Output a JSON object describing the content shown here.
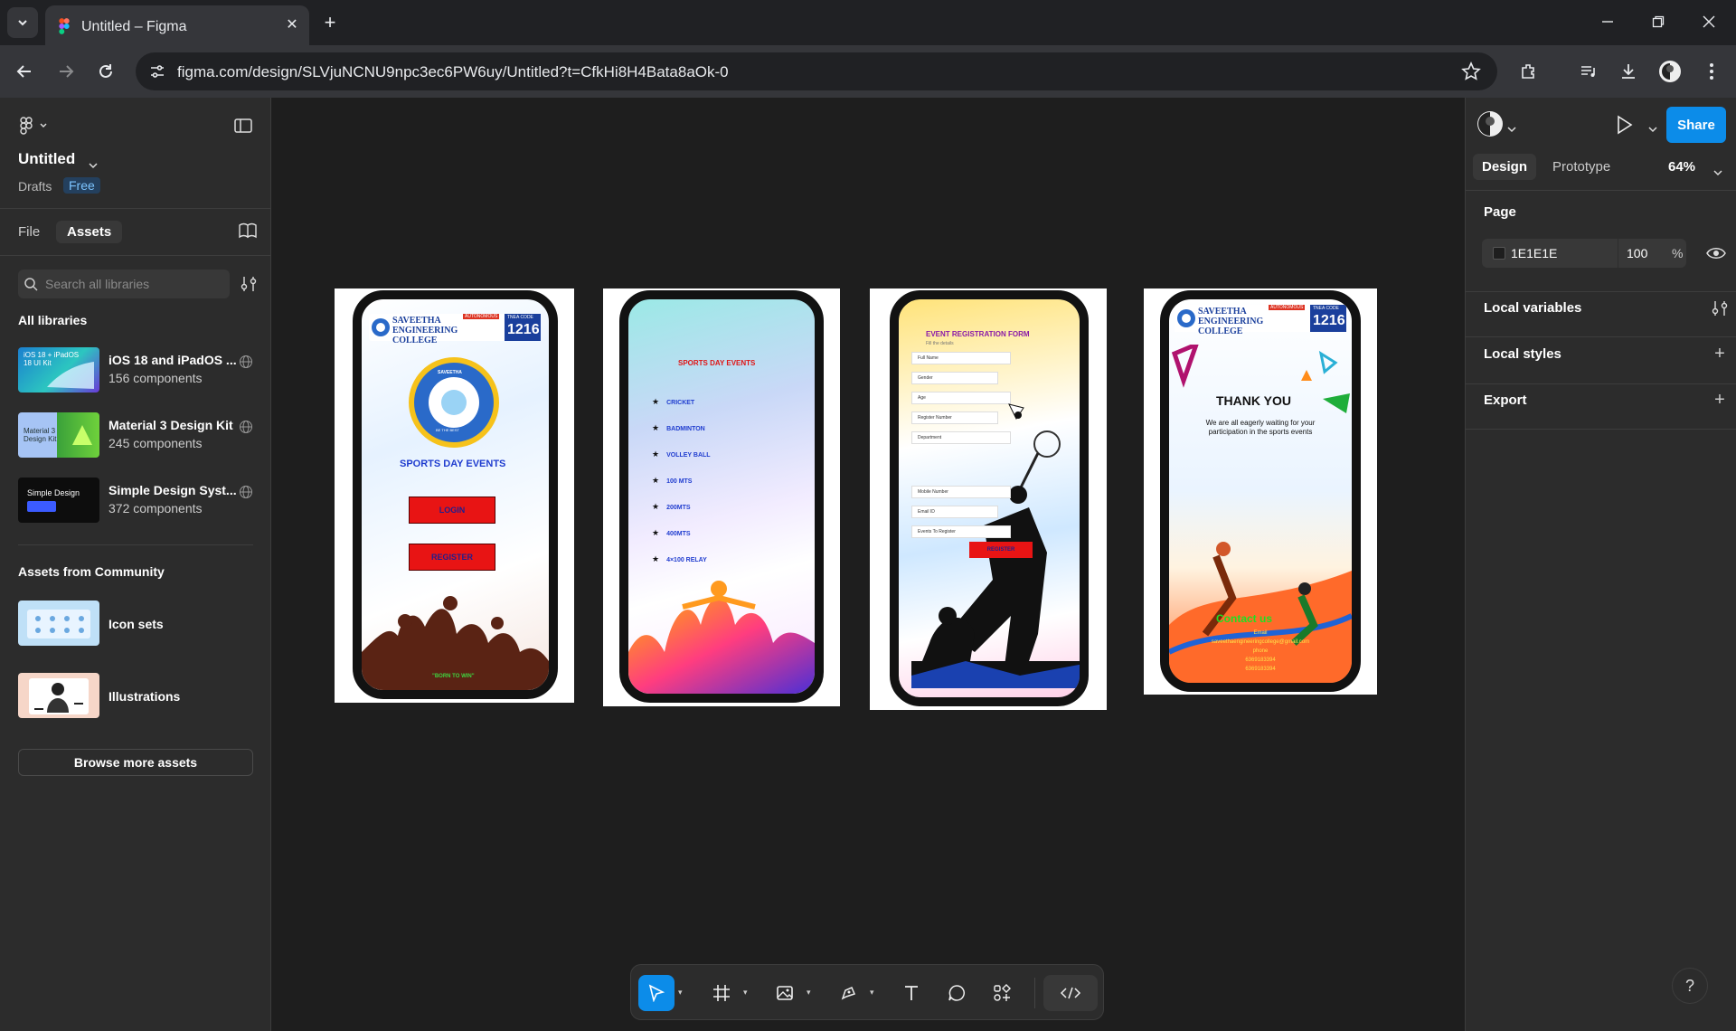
{
  "browser": {
    "tab_title": "Untitled – Figma",
    "url": "figma.com/design/SLVjuNCNU9npc3ec6PW6uy/Untitled?t=CfkHi8H4Bata8aOk-0"
  },
  "left_panel": {
    "file_title": "Untitled",
    "drafts_label": "Drafts",
    "plan_badge": "Free",
    "tabs": [
      "File",
      "Assets"
    ],
    "search_placeholder": "Search all libraries",
    "all_libraries_heading": "All libraries",
    "libraries": [
      {
        "name": "iOS 18 and iPadOS ...",
        "count": "156 components",
        "thumb_text": "iOS 18 + iPadOS 18 UI Kit"
      },
      {
        "name": "Material 3 Design Kit",
        "count": "245 components",
        "thumb_text": "Material 3 Design Kit"
      },
      {
        "name": "Simple Design Syst...",
        "count": "372 components",
        "thumb_text": "Simple Design System"
      }
    ],
    "community_heading": "Assets from Community",
    "community": [
      {
        "name": "Icon sets"
      },
      {
        "name": "Illustrations"
      }
    ],
    "browse_button": "Browse more assets"
  },
  "right_panel": {
    "share_button": "Share",
    "tabs": [
      "Design",
      "Prototype"
    ],
    "zoom": "64%",
    "page_heading": "Page",
    "page_fill_hex": "1E1E1E",
    "page_fill_opacity": "100",
    "page_fill_pct": "%",
    "sections": [
      "Local variables",
      "Local styles",
      "Export"
    ],
    "help": "?"
  },
  "canvas": {
    "background": "#1e1e1e",
    "screens": [
      {
        "college_name": "SAVEETHA ENGINEERING COLLEGE",
        "autonomous": "AUTONOMOUS",
        "code_label": "TNEA CODE",
        "code": "1216",
        "emblem_top": "SAVEETHA",
        "emblem_bottom": "BE THE BEST",
        "title": "SPORTS DAY EVENTS",
        "login": "LOGIN",
        "register": "REGISTER",
        "tagline": "\"BORN TO WIN\""
      },
      {
        "title": "SPORTS DAY EVENTS",
        "events": [
          "CRICKET",
          "BADMINTON",
          "VOLLEY BALL",
          "100 MTS",
          "200MTS",
          "400MTS",
          "4×100 RELAY"
        ]
      },
      {
        "title": "EVENT REGISTRATION FORM",
        "subtitle": "Fill the details",
        "fields_top": [
          "Full Name",
          "Gender",
          "Age",
          "Register Number",
          "Department"
        ],
        "fields_bottom": [
          "Mobile Number",
          "Email ID",
          "Events To Register"
        ],
        "register": "REGISTER"
      },
      {
        "college_name": "SAVEETHA ENGINEERING COLLEGE",
        "autonomous": "AUTONOMOUS",
        "code_label": "TNEA CODE",
        "code": "1216",
        "thanks": "THANK YOU",
        "message": "We are all eagerly waiting for your participation in the sports events",
        "contact_title": "Contact us",
        "contact_lines": [
          "Email",
          "saveethaengineeringcollege@gmail.com",
          "phone",
          "6369183394",
          "6369183394"
        ]
      }
    ]
  }
}
